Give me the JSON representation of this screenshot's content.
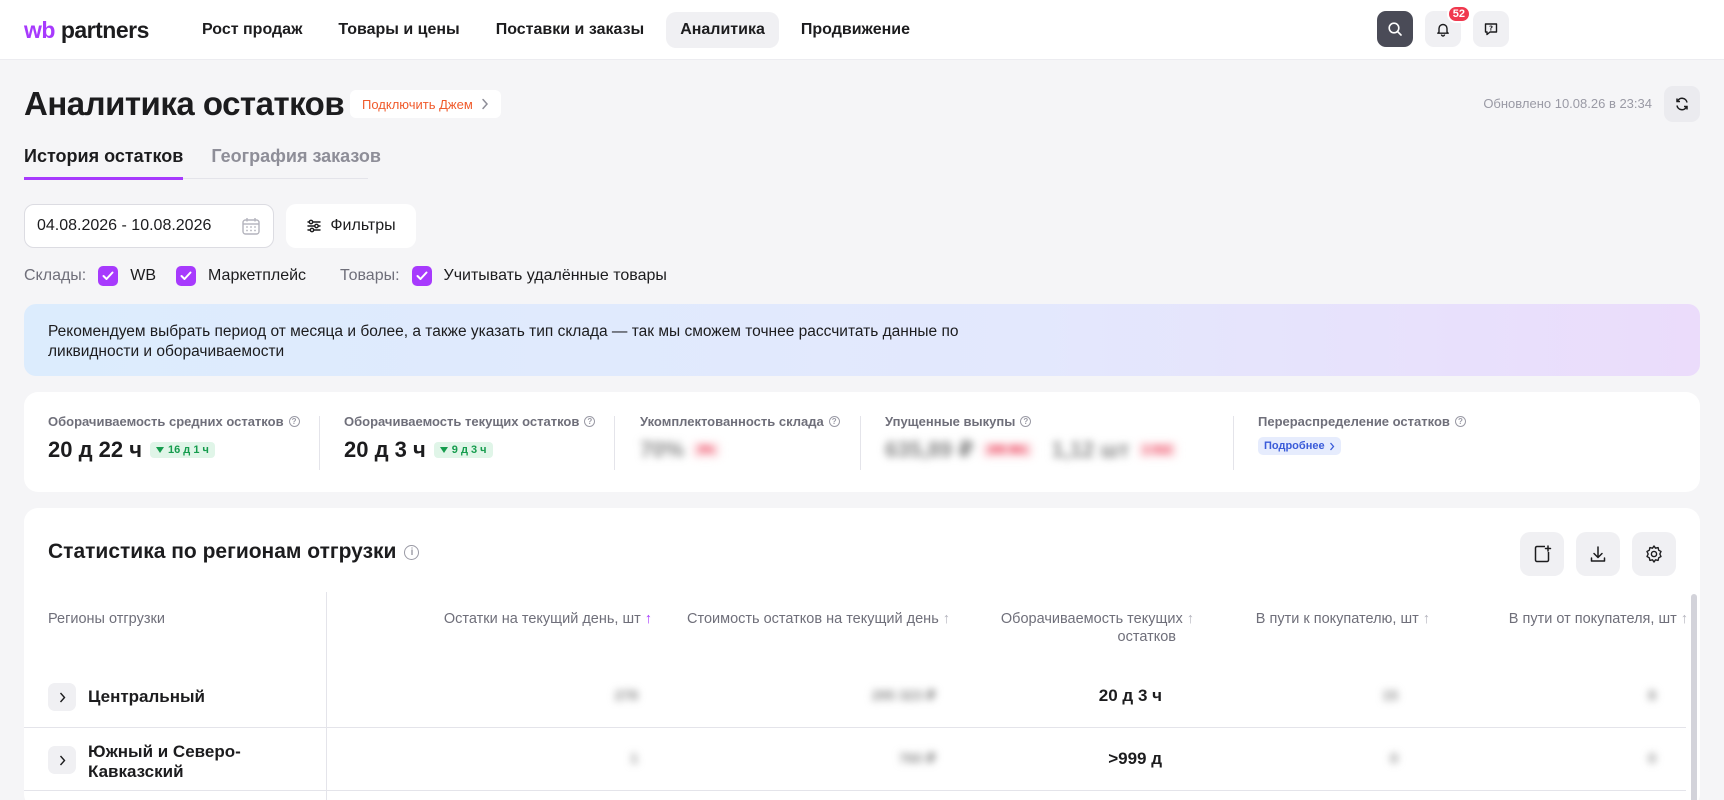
{
  "app": {
    "logo_prefix": "wb",
    "logo_rest": " partners"
  },
  "nav": [
    "Рост продаж",
    "Товары и цены",
    "Поставки и заказы",
    "Аналитика",
    "Продвижение"
  ],
  "notifications": {
    "count": "52"
  },
  "page": {
    "title": "Аналитика остатков",
    "jam_label": "Подключить Джем",
    "updated": "Обновлено 10.08.26 в 23:34"
  },
  "tabs": [
    "История остатков",
    "География заказов"
  ],
  "filters": {
    "date_range": "04.08.2026 - 10.08.2026",
    "filters_label": "Фильтры",
    "warehouses_label": "Склады:",
    "warehouse_wb": "WB",
    "warehouse_mp": "Маркетплейс",
    "goods_label": "Товары:",
    "goods_deleted": "Учитывать удалённые товары"
  },
  "banner": "Рекомендуем выбрать период от месяца и более, а также указать тип склада — так мы сможем точнее рассчитать данные по ликвидности и оборачиваемости",
  "kpis": [
    {
      "title": "Оборачиваемость средних остатков",
      "value": "20 д 22 ч",
      "delta": "16 д 1 ч"
    },
    {
      "title": "Оборачиваемость текущих остатков",
      "value": "20 д 3 ч",
      "delta": "9 д 3 ч"
    },
    {
      "title": "Укомплектованность склада",
      "value": "70%",
      "delta": "3%"
    },
    {
      "title": "Упущенные выкупы",
      "value": "635,89 ₽",
      "delta": "295 861",
      "value2": "1,12 шт",
      "delta2": "1 012"
    },
    {
      "title": "Перераспределение остатков",
      "more": "Подробнее"
    }
  ],
  "table": {
    "title": "Статистика по регионам отгрузки",
    "columns": [
      "Регионы отгрузки",
      "Остатки на текущий день, шт",
      "Стоимость остатков на текущий день",
      "Оборачиваемость текущих",
      "остатков",
      "В пути к покупателю, шт",
      "В пути от покупателя, шт"
    ],
    "rows": [
      {
        "region": "Центральный",
        "stock": "278",
        "value": "295 323 ₽",
        "turnover": "20 д 3 ч",
        "to_buyer": "15",
        "from_buyer": "8"
      },
      {
        "region_line1": "Южный и Северо-",
        "region_line2": "Кавказский",
        "stock": "1",
        "value": "760 ₽",
        "turnover": ">999 д",
        "to_buyer": "0",
        "from_buyer": "0"
      }
    ]
  }
}
